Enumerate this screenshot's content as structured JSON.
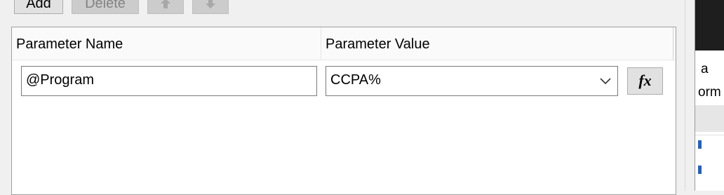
{
  "toolbar": {
    "add_label": "Add",
    "delete_label": "Delete",
    "move_up_icon": "arrow-up-icon",
    "move_down_icon": "arrow-down-icon"
  },
  "grid": {
    "columns": [
      "Parameter Name",
      "Parameter Value"
    ],
    "rows": [
      {
        "name": "@Program",
        "value": "CCPA%",
        "expression_button": "fx"
      }
    ]
  },
  "right_panel": {
    "fragments": [
      "a",
      "orm"
    ]
  }
}
